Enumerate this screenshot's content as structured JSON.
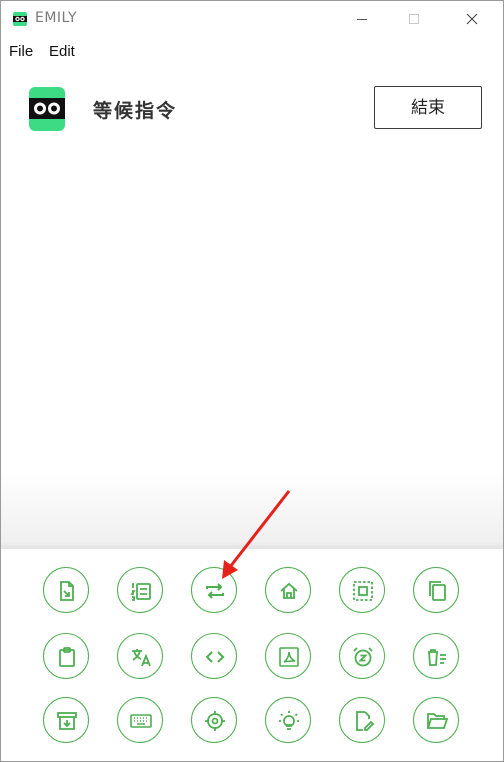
{
  "window": {
    "title": "EMILY"
  },
  "menu": {
    "file_label": "File",
    "edit_label": "Edit"
  },
  "header": {
    "status": "等候指令",
    "end_button_label": "結束"
  },
  "colors": {
    "accent_green": "#4caf50",
    "logo_green": "#3ddc84",
    "arrow_red": "#e8201a"
  },
  "tools": [
    {
      "icon": "file-import-icon"
    },
    {
      "icon": "list-numbered-icon"
    },
    {
      "icon": "repeat-icon"
    },
    {
      "icon": "home-icon"
    },
    {
      "icon": "select-all-icon"
    },
    {
      "icon": "copy-icon"
    },
    {
      "icon": "clipboard-icon"
    },
    {
      "icon": "translate-icon"
    },
    {
      "icon": "code-icon"
    },
    {
      "icon": "pdf-icon"
    },
    {
      "icon": "snooze-alarm-icon"
    },
    {
      "icon": "delete-list-icon"
    },
    {
      "icon": "archive-download-icon"
    },
    {
      "icon": "keyboard-icon"
    },
    {
      "icon": "crosshair-icon"
    },
    {
      "icon": "lightbulb-icon"
    },
    {
      "icon": "edit-file-icon"
    },
    {
      "icon": "folder-open-icon"
    }
  ]
}
